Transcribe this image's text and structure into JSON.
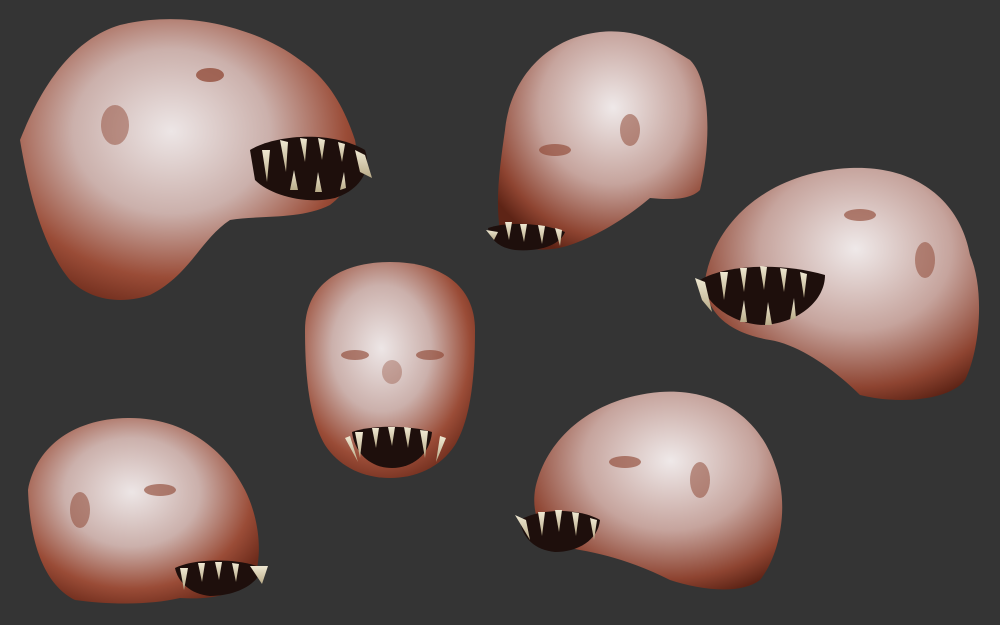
{
  "canvas": {
    "background": "#343434",
    "skin_light": "#e6dede",
    "skin_mid": "#c9a9a3",
    "skin_dark": "#8a3f2b",
    "shadow": "#5a2418",
    "teeth": "#d8cfb4",
    "mouth": "#1e0f0c"
  },
  "sculpts": [
    {
      "view": "three-quarter-right-top"
    },
    {
      "view": "three-quarter-left-top"
    },
    {
      "view": "front"
    },
    {
      "view": "three-quarter-left-mid"
    },
    {
      "view": "three-quarter-right-bottom"
    },
    {
      "view": "three-quarter-left-bottom"
    }
  ]
}
